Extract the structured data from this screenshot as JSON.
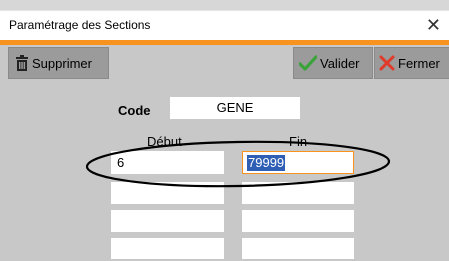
{
  "window": {
    "title": "Paramétrage des Sections",
    "close_glyph": "✕"
  },
  "toolbar": {
    "supprimer_label": "Supprimer",
    "valider_label": "Valider",
    "fermer_label": "Fermer"
  },
  "form": {
    "code_label": "Code",
    "code_value": "GENE",
    "col_debut": "Début",
    "col_fin": "Fin",
    "rows": [
      {
        "debut": "6",
        "fin": "79999"
      },
      {
        "debut": "",
        "fin": ""
      },
      {
        "debut": "",
        "fin": ""
      },
      {
        "debut": "",
        "fin": ""
      }
    ]
  },
  "colors": {
    "accent": "#f7931e",
    "selection": "#2f5fb5",
    "background": "#c8c8c8",
    "check_green": "#3aa33a",
    "cross_red": "#e03a2a"
  },
  "icons": [
    "trash-icon",
    "check-icon",
    "close-icon"
  ]
}
